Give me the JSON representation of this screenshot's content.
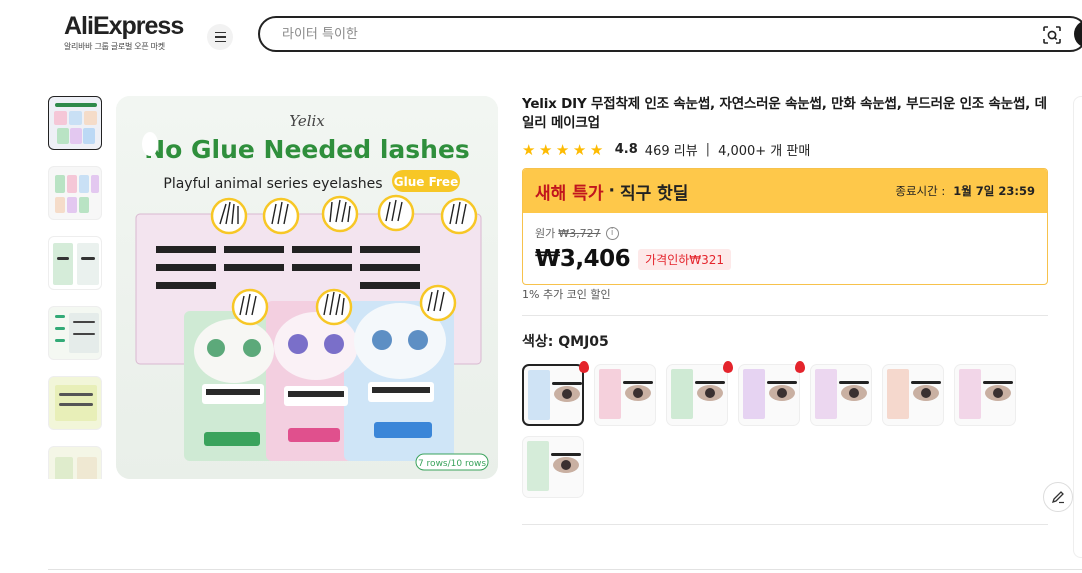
{
  "header": {
    "logo": "AliExpress",
    "logo_sub": "알리바바 그룹 글로벌 오픈 마켓",
    "search_placeholder": "라이터 특이한"
  },
  "product": {
    "title": "Yelix DIY 무접착제 인조 속눈썹, 자연스러운 속눈썹, 만화 속눈썹, 부드러운 인조 속눈썹, 데일리 메이크업",
    "rating": "4.8",
    "reviews": "469 리뷰",
    "sold": "4,000+ 개 판매",
    "rating_stars": 5,
    "deal": {
      "name": "새해 특가",
      "dot": "·",
      "sub": "직구 핫딜",
      "end_label": "종료시간 :",
      "end_time": "1월 7일 23:59"
    },
    "original_label": "원가",
    "original_price": "₩3,727",
    "price": "₩3,406",
    "discount": "가격인하₩321",
    "coin": "1% 추가 코인 할인",
    "color_label": "색상: QMJ05"
  },
  "main_image": {
    "brand": "Yelix",
    "headline": "No Glue Needed lashes",
    "subline": "Playful animal series  eyelashes",
    "badge": "Glue Free",
    "rows": "7 rows/10 rows"
  },
  "colors": {
    "accent": "#fec84a",
    "deal_red": "#c1151d",
    "discount_red": "#e4242c",
    "star": "#fdbb03"
  },
  "icons": {
    "menu": "hamburger-menu-icon",
    "camera": "image-search-icon",
    "info": "info-icon",
    "edit": "pencil-icon",
    "hot": "fire-icon"
  }
}
